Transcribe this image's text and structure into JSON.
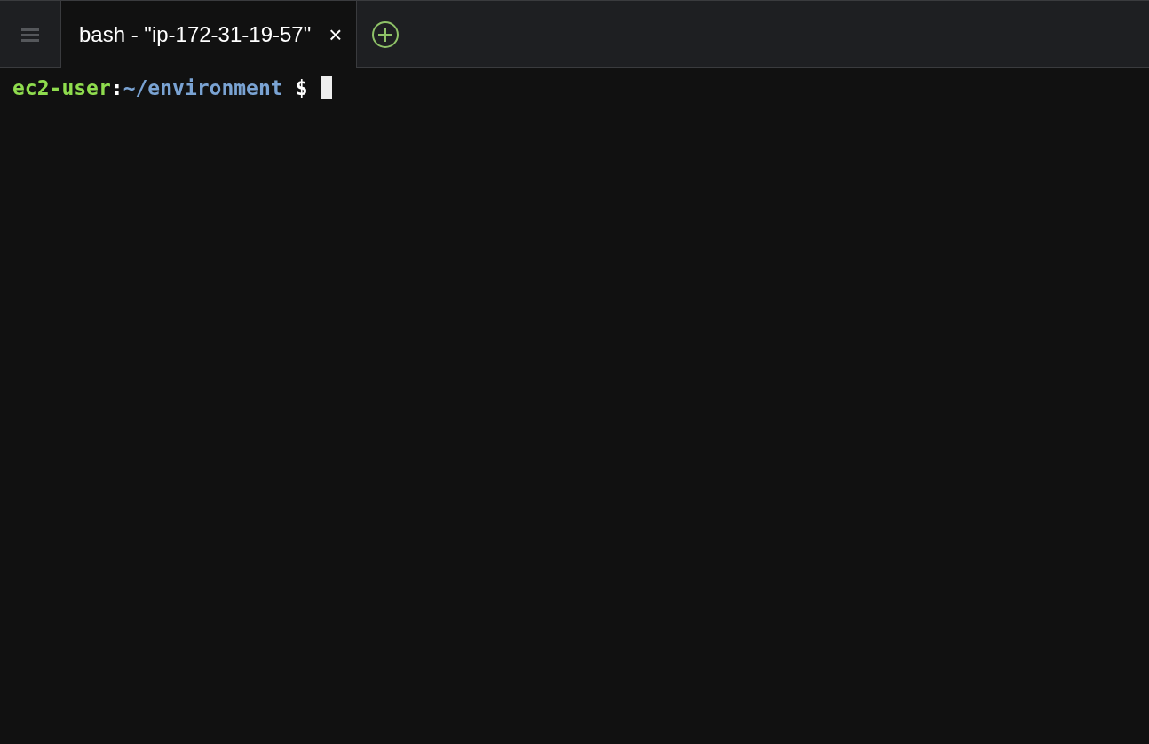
{
  "tabs": [
    {
      "label": "bash - \"ip-172-31-19-57\"",
      "selected": true,
      "close": "×"
    }
  ],
  "prompt": {
    "user": "ec2-user",
    "separator": ":",
    "path": "~/environment",
    "symbol": "$"
  }
}
